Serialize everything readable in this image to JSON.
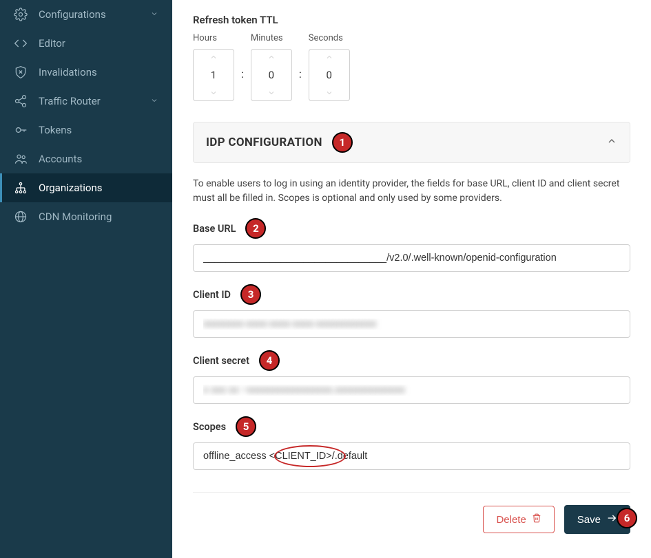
{
  "sidebar": {
    "items": [
      {
        "label": "Configurations"
      },
      {
        "label": "Editor"
      },
      {
        "label": "Invalidations"
      },
      {
        "label": "Traffic Router"
      },
      {
        "label": "Tokens"
      },
      {
        "label": "Accounts"
      },
      {
        "label": "Organizations"
      },
      {
        "label": "CDN Monitoring"
      }
    ]
  },
  "ttl": {
    "title": "Refresh token TTL",
    "units": {
      "hours": "Hours",
      "minutes": "Minutes",
      "seconds": "Seconds"
    },
    "values": {
      "hours": "1",
      "minutes": "0",
      "seconds": "0"
    },
    "colon": ":"
  },
  "idp": {
    "title": "IDP CONFIGURATION",
    "help": "To enable users to log in using an identity provider, the fields for base URL, client ID and client secret must all be filled in. Scopes is optional and only used by some providers.",
    "fields": {
      "base_url": {
        "label": "Base URL",
        "value": "_________________________________/v2.0/.well-known/openid-configuration"
      },
      "client_id": {
        "label": "Client ID",
        "value": "xxxxxxxx-xxxx-xxxx-xxxx-xxxxxxxxxxxx"
      },
      "client_secret": {
        "label": "Client secret",
        "value": "x xxx xx ~xxxxxxxxxxxxxxxxx.xxxxxxxxxxxxxx"
      },
      "scopes": {
        "label": "Scopes",
        "value": "offline_access <CLIENT_ID>/.default"
      }
    }
  },
  "markers": {
    "m1": "1",
    "m2": "2",
    "m3": "3",
    "m4": "4",
    "m5": "5",
    "m6": "6"
  },
  "actions": {
    "delete": "Delete",
    "save": "Save"
  }
}
